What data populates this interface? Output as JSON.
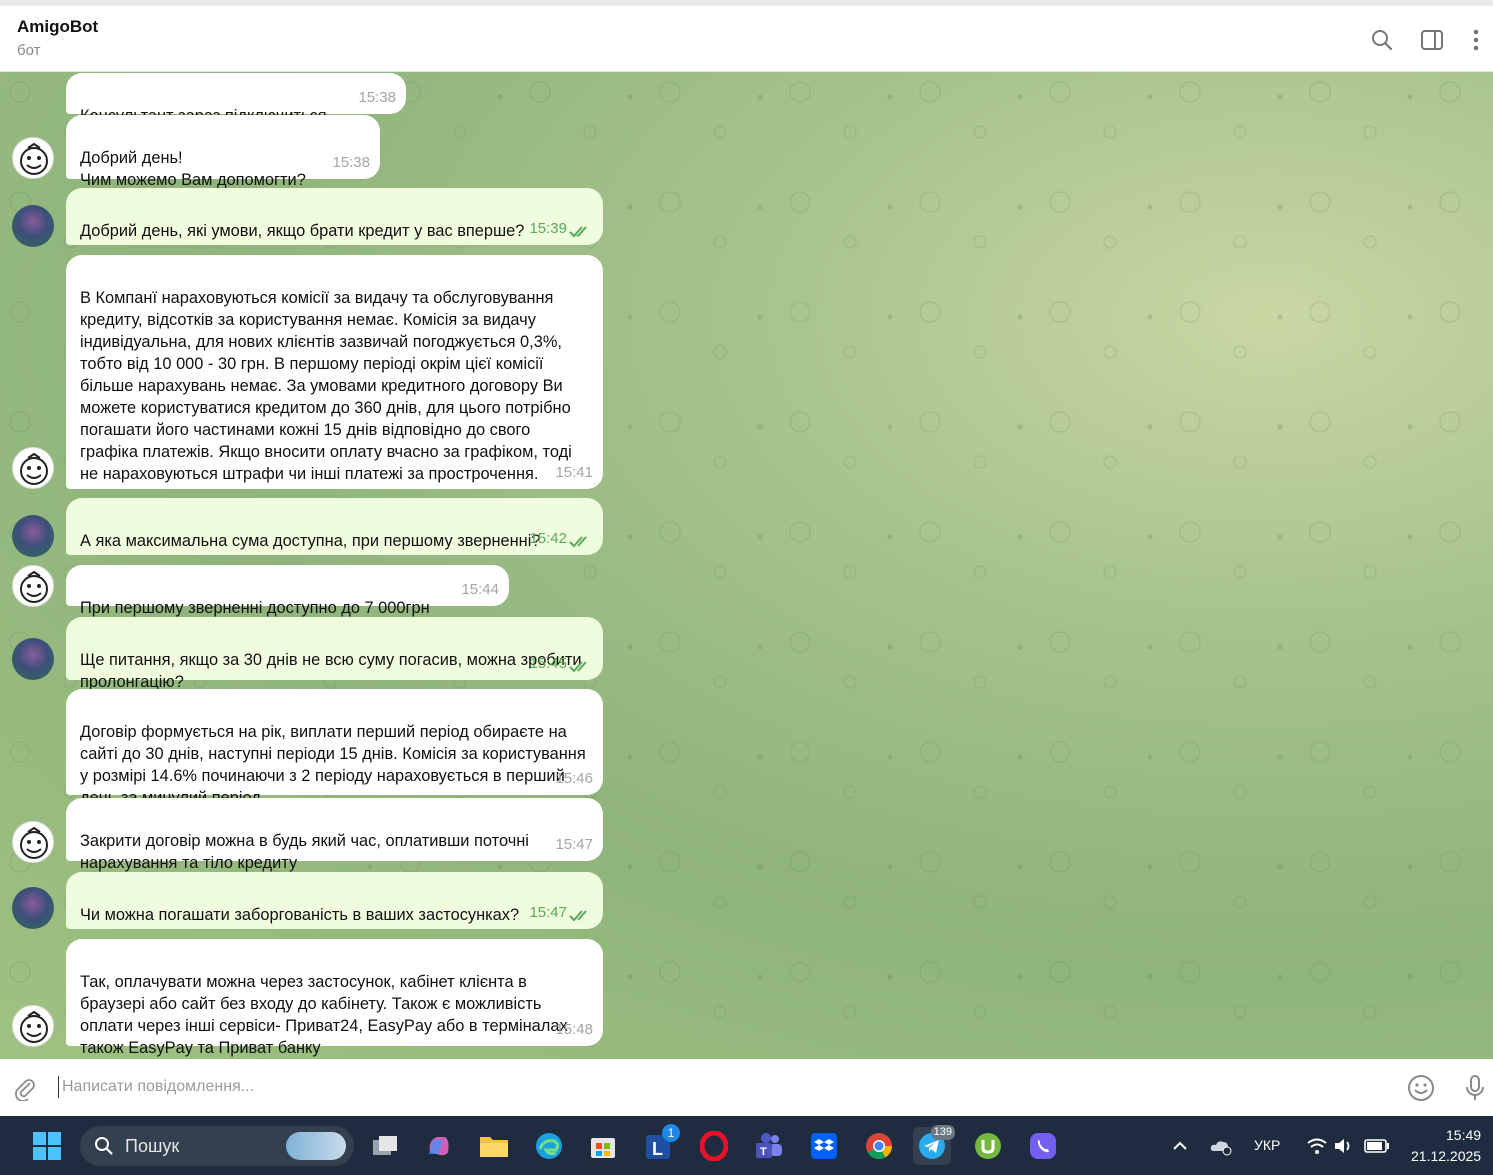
{
  "header": {
    "title": "AmigoBot",
    "subtitle": "бот",
    "icons": [
      "search-icon",
      "sidebar-toggle-icon",
      "more-vertical-icon"
    ]
  },
  "messages": [
    {
      "dir": "in",
      "text": "Консультант зараз підключиться.",
      "time": "15:38"
    },
    {
      "dir": "in",
      "text": "Добрий день!\nЧим можемо Вам допомогти?",
      "time": "15:38"
    },
    {
      "dir": "out",
      "text": "Добрий день, які умови, якщо брати кредит у вас вперше?",
      "time": "15:39"
    },
    {
      "dir": "in",
      "text": "В Компанї нараховуються комісії за видачу та обслуговування кредиту, відсотків  за користування немає. Комісія за видачу індивідуальна, для нових клієнтів зазвичай погоджується 0,3%, тобто від 10 000 - 30 грн. В першому періоді окрім цієї комісії більше нарахувань немає. За умовами кредитного договору Ви можете користуватися кредитом до 360 днів, для цього потрібно погашати його частинами кожні 15 днів відповідно до свого графіка платежів. Якщо вносити оплату вчасно за графіком, тоді не нараховуються штрафи чи інші платежі за прострочення.",
      "time": "15:41"
    },
    {
      "dir": "out",
      "text": "А яка максимальна сума доступна, при першому зверненні?",
      "time": "15:42"
    },
    {
      "dir": "in",
      "text": "При першому зверненні доступно до 7 000грн",
      "time": "15:44"
    },
    {
      "dir": "out",
      "text": "Ще питання, якщо за 30 днів не всю суму погасив, можна зробити пролонгацію?",
      "time": "15:45"
    },
    {
      "dir": "in",
      "text": "Договір формується на рік, виплати перший період обираєте на сайті до 30 днів, наступні періоди 15 днів. Комісія за користування у розмірі 14.6% починаючи з 2 періоду нараховується в перший день за минулий період",
      "time": "15:46"
    },
    {
      "dir": "in",
      "text": "Закрити договір можна в будь який час, оплативши поточні нарахування та тіло кредиту",
      "time": "15:47"
    },
    {
      "dir": "out",
      "text": "Чи можна погашати заборгованість в ваших застосунках?",
      "time": "15:47"
    },
    {
      "dir": "in",
      "text": "Так, оплачувати можна через застосунок, кабінет клієнта в браузері або сайт без входу до кабінету. Також є можливість оплати через інші сервіси- Приват24, EasyPay  або в терміналах також EasyPay  та Приват банку",
      "time": "15:48"
    }
  ],
  "composer": {
    "placeholder": "Написати повідомлення..."
  },
  "taskbar": {
    "search_label": "Пошук",
    "lang": "УКР",
    "time": "15:49",
    "date": "21.12.2025",
    "badge_l": "1",
    "badge_telegram": "139"
  },
  "colors": {
    "incoming_bubble": "#ffffff",
    "outgoing_bubble": "#effdde",
    "outgoing_time": "#5aa858",
    "taskbar": "#1f2c3f"
  }
}
